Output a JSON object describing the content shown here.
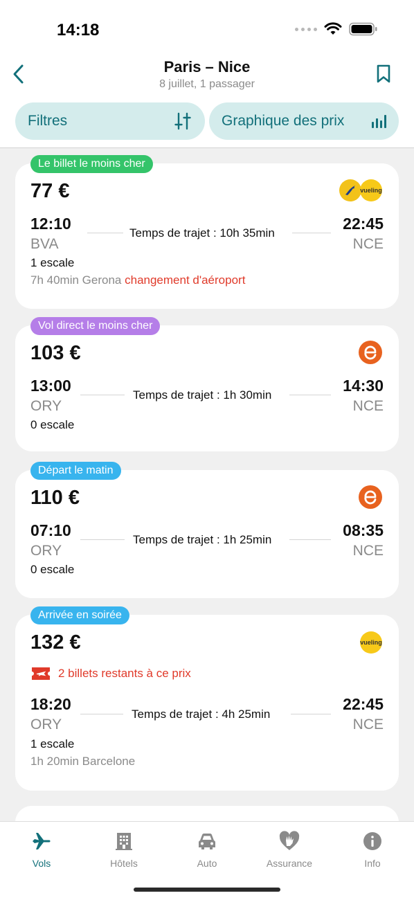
{
  "status": {
    "time": "14:18"
  },
  "header": {
    "title": "Paris – Nice",
    "subtitle": "8 juillet, 1 passager"
  },
  "controls": {
    "filters_label": "Filtres",
    "chart_label": "Graphique des prix"
  },
  "colors": {
    "accent": "#12707a",
    "alert": "#e03a2a",
    "tag_green": "#34c46a",
    "tag_purple": "#b57ee8",
    "tag_blue": "#38b4ee"
  },
  "flights": [
    {
      "tag": "Le billet le moins cher",
      "price": "77 €",
      "airlines": [
        "ryanair-logo",
        "vueling-logo"
      ],
      "dep_time": "12:10",
      "dep_code": "BVA",
      "arr_time": "22:45",
      "arr_code": "NCE",
      "duration": "Temps de trajet : 10h 35min",
      "stops": "1 escale",
      "detail": "7h 40min Gerona",
      "warning": "changement d'aéroport"
    },
    {
      "tag": "Vol direct le moins cher",
      "price": "103 €",
      "airlines": [
        "easyjet-logo"
      ],
      "dep_time": "13:00",
      "dep_code": "ORY",
      "arr_time": "14:30",
      "arr_code": "NCE",
      "duration": "Temps de trajet : 1h 30min",
      "stops": "0 escale"
    },
    {
      "tag": "Départ le matin",
      "price": "110 €",
      "airlines": [
        "easyjet-logo"
      ],
      "dep_time": "07:10",
      "dep_code": "ORY",
      "arr_time": "08:35",
      "arr_code": "NCE",
      "duration": "Temps de trajet : 1h 25min",
      "stops": "0 escale"
    },
    {
      "tag": "Arrivée en soirée",
      "price": "132 €",
      "airlines": [
        "vueling-logo"
      ],
      "alert": "2 billets restants à ce prix",
      "dep_time": "18:20",
      "dep_code": "ORY",
      "arr_time": "22:45",
      "arr_code": "NCE",
      "duration": "Temps de trajet : 4h 25min",
      "stops": "1 escale",
      "detail": "1h 20min Barcelone"
    }
  ],
  "logos": {
    "vueling_text": "vueling"
  },
  "tabs": [
    {
      "label": "Vols",
      "icon": "plane-icon",
      "active": true
    },
    {
      "label": "Hôtels",
      "icon": "building-icon"
    },
    {
      "label": "Auto",
      "icon": "car-icon"
    },
    {
      "label": "Assurance",
      "icon": "heart-hand-icon"
    },
    {
      "label": "Info",
      "icon": "info-icon"
    }
  ]
}
